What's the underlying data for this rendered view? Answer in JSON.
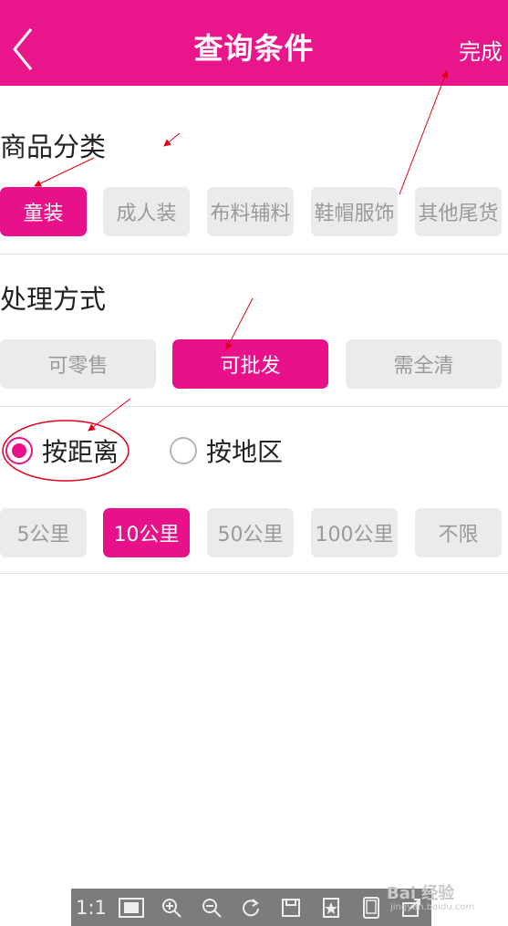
{
  "nav": {
    "title": "查询条件",
    "done_label": "完成"
  },
  "category": {
    "title": "商品分类",
    "options": [
      "童装",
      "成人装",
      "布料辅料",
      "鞋帽服饰",
      "其他尾货"
    ],
    "selected": "童装"
  },
  "handling": {
    "title": "处理方式",
    "options": [
      "可零售",
      "可批发",
      "需全清"
    ],
    "selected": "可批发"
  },
  "location_mode": {
    "options": [
      "按距离",
      "按地区"
    ],
    "selected": "按距离"
  },
  "distance": {
    "options": [
      "5公里",
      "10公里",
      "50公里",
      "100公里",
      "不限"
    ],
    "selected": "10公里"
  },
  "viewer_toolbar": {
    "actual_size_label": "1:1",
    "icons": [
      "fit-screen-icon",
      "zoom-in-icon",
      "zoom-out-icon",
      "rotate-icon",
      "save-icon",
      "bookmark-icon",
      "tablet-icon",
      "share-icon"
    ]
  },
  "watermark": {
    "text": "Bai 经验",
    "sub": "jingyan.baidu.com"
  },
  "colors": {
    "accent": "#e8118a",
    "chip_bg": "#ebebeb",
    "chip_text": "#9a9a9a",
    "annotation": "#e0001a"
  }
}
